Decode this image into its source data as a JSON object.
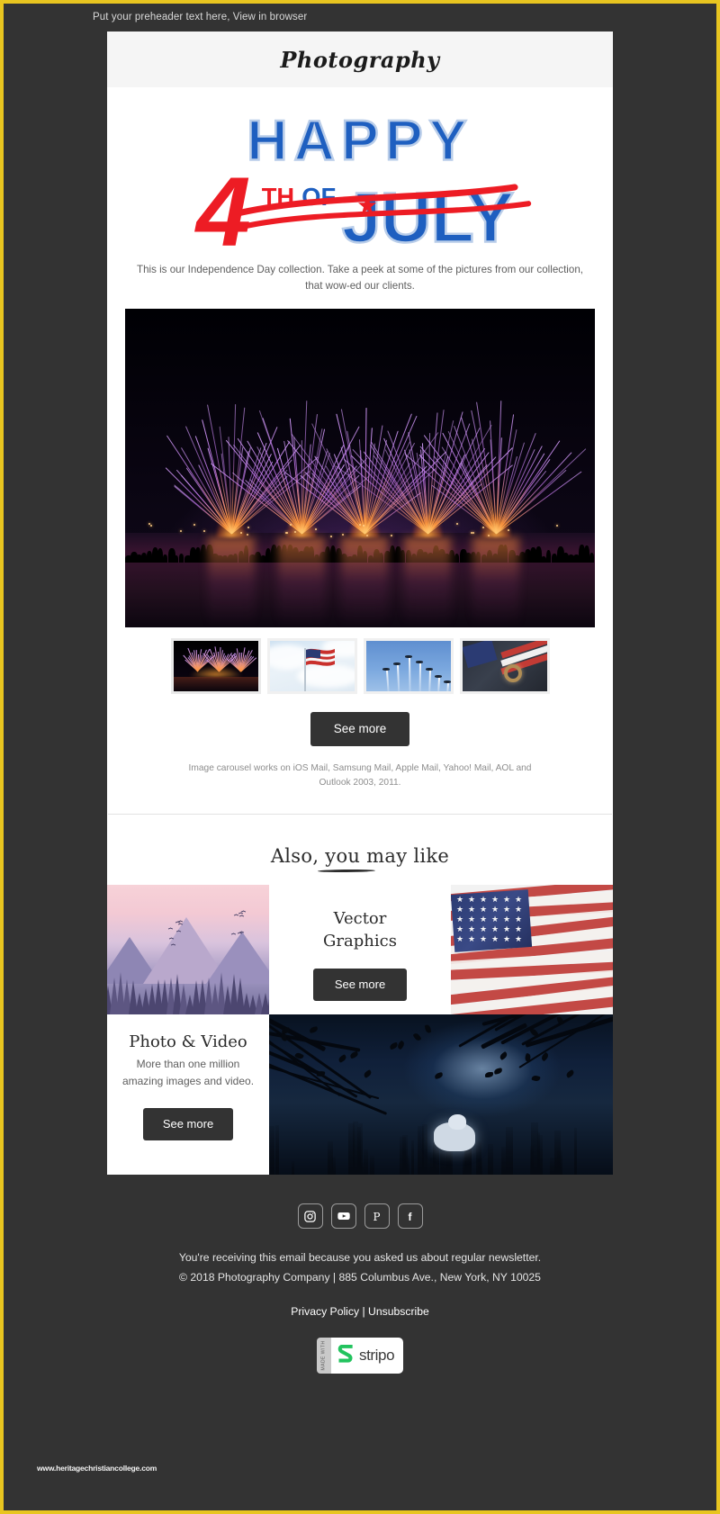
{
  "preheader": {
    "text": "Put your preheader text here, View in browser"
  },
  "brand": {
    "logo": "Photography",
    "accent_yellow": "#e8c520",
    "dark": "#333333"
  },
  "hero": {
    "banner_line1": "HAPPY",
    "banner_number": "4",
    "banner_th": "TH",
    "banner_of": "OF",
    "banner_month": "JULY",
    "banner_blue": "#1e5fc0",
    "banner_red": "#ed1c24",
    "intro": "This is our Independence Day collection. Take a peek at some of the pictures from our collection, that wow-ed our clients.",
    "main_image_alt": "fireworks-over-water"
  },
  "carousel": {
    "thumbs": [
      {
        "alt": "fireworks-thumbnail"
      },
      {
        "alt": "american-flag-thumbnail"
      },
      {
        "alt": "jets-flyover-thumbnail"
      },
      {
        "alt": "ring-on-flag-thumbnail"
      }
    ],
    "cta": "See more",
    "note": "Image carousel works on iOS Mail, Samsung Mail, Apple Mail, Yahoo! Mail, AOL and Outlook 2003, 2011."
  },
  "also": {
    "title": "Also, you may like",
    "blocks": [
      {
        "image_alt": "mountain-landscape",
        "title": "Vector\nGraphics",
        "title_line1": "Vector",
        "title_line2": "Graphics",
        "cta": "See more",
        "flag_alt": "grunge-american-flag"
      },
      {
        "title": "Photo & Video",
        "subtitle_line1": "More than one million",
        "subtitle_line2": "amazing images and video.",
        "cta": "See more",
        "image_alt": "wolf-in-dark-forest"
      }
    ]
  },
  "footer": {
    "socials": [
      {
        "name": "instagram",
        "glyph": "instagram-icon"
      },
      {
        "name": "youtube",
        "glyph": "youtube-icon"
      },
      {
        "name": "pinterest",
        "glyph": "pinterest-icon"
      },
      {
        "name": "facebook",
        "glyph": "facebook-icon"
      }
    ],
    "line1": "You're receiving this email because you asked us about regular newsletter.",
    "line2": "© 2018 Photography Company | 885 Columbus Ave., New York, NY 10025",
    "privacy": "Privacy Policy",
    "separator": " | ",
    "unsubscribe": "Unsubscribe",
    "badge_made_with": "MADE WITH",
    "badge_word": "stripo",
    "badge_green": "#22c35e"
  },
  "watermark": {
    "text": "www.heritagechristiancollege.com"
  }
}
